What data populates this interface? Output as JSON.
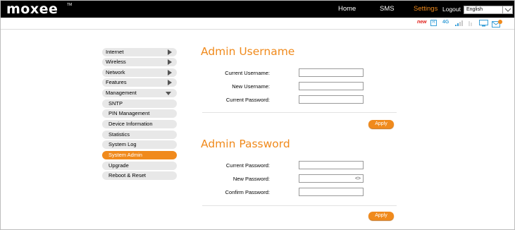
{
  "brand": {
    "name": "moxee",
    "tm": "TM"
  },
  "header": {
    "nav": {
      "home": "Home",
      "sms": "SMS",
      "settings": "Settings",
      "logout": "Logout"
    },
    "language": {
      "selected": "English"
    }
  },
  "status": {
    "new_badge": "new",
    "roaming": "R",
    "network": "4G"
  },
  "colors": {
    "accent": "#f08a1c",
    "topbar": "#000000",
    "menu_bg": "#e8e8e8"
  },
  "sidebar": {
    "items": [
      {
        "label": "Internet"
      },
      {
        "label": "Wireless"
      },
      {
        "label": "Network"
      },
      {
        "label": "Features"
      },
      {
        "label": "Management"
      }
    ],
    "subitems": [
      {
        "label": "SNTP"
      },
      {
        "label": "PIN Management"
      },
      {
        "label": "Device Information"
      },
      {
        "label": "Statistics"
      },
      {
        "label": "System Log"
      },
      {
        "label": "System Admin"
      },
      {
        "label": "Upgrade"
      },
      {
        "label": "Reboot & Reset"
      }
    ]
  },
  "username_section": {
    "title": "Admin Username",
    "current_username": {
      "label": "Current Username:",
      "value": ""
    },
    "new_username": {
      "label": "New Username:",
      "value": ""
    },
    "current_password": {
      "label": "Current Password:",
      "value": ""
    },
    "apply": "Apply"
  },
  "password_section": {
    "title": "Admin Password",
    "current_password": {
      "label": "Current Password:",
      "value": ""
    },
    "new_password": {
      "label": "New Password:",
      "value": ""
    },
    "confirm_password": {
      "label": "Confirm Password:",
      "value": ""
    },
    "apply": "Apply"
  }
}
